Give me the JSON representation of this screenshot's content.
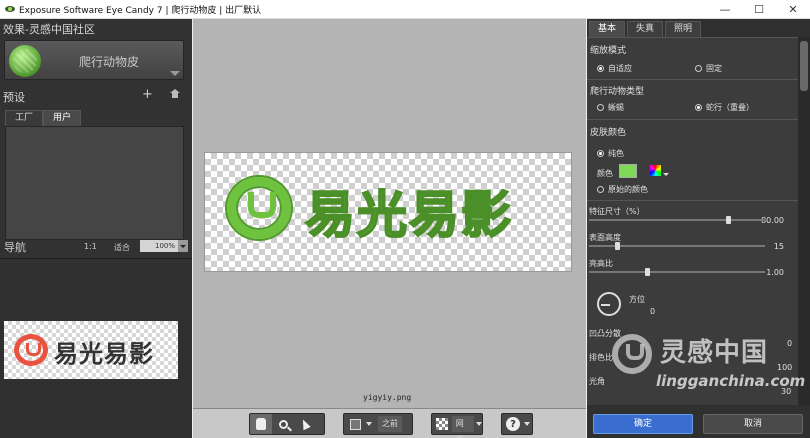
{
  "window": {
    "title": "Exposure Software Eye Candy 7 | 爬行动物皮 | 出厂默认",
    "min": "—",
    "max": "☐",
    "close": "✕"
  },
  "left": {
    "effect_section": "效果-灵感中国社区",
    "effect_name": "爬行动物皮",
    "presets_title": "预设",
    "preset_add": "+",
    "preset_tabs": [
      "工厂",
      "用户"
    ],
    "nav_title": "导航",
    "nav_ratio": "1:1",
    "nav_fit": "适合",
    "nav_zoom": "100%",
    "thumb_text": "易光易影"
  },
  "canvas": {
    "image_text": "易光易影",
    "caption": "yigyiy.png"
  },
  "toolbar": {
    "before_label": "之前",
    "grid_label": "网格",
    "help": "?"
  },
  "right": {
    "tabs": [
      "基本",
      "失真",
      "照明"
    ],
    "scale_mode_title": "缩放模式",
    "scale_auto": "自适应",
    "scale_fixed": "固定",
    "reptile_type_title": "爬行动物类型",
    "type_lizard": "蜥蜴",
    "type_snake": "蛇行（重叠）",
    "skin_color_title": "皮肤颜色",
    "solid_color": "纯色",
    "color_label": "颜色",
    "original_colors": "原始的颜色",
    "colors": {
      "skin_color": "#7ed957",
      "ok_button": "#3a6fd0"
    },
    "sliders": [
      {
        "label": "特征尺寸（%）",
        "value_text": "80.00",
        "position": 0.8
      },
      {
        "label": "表面高度",
        "value_text": "15",
        "position": 0.15
      },
      {
        "label": "亮高比",
        "value_text": "1.00",
        "position": 0.33
      }
    ],
    "direction_label": "方位",
    "direction_value": "0",
    "partial_1": "凹凸分散",
    "partial_2": "排色比",
    "partial_3": "光角",
    "partial_values": [
      "0",
      "100",
      "30"
    ],
    "ok": "确定",
    "cancel": "取消"
  },
  "watermark": {
    "cn": "灵感中国",
    "en": "lingganchina.com"
  }
}
